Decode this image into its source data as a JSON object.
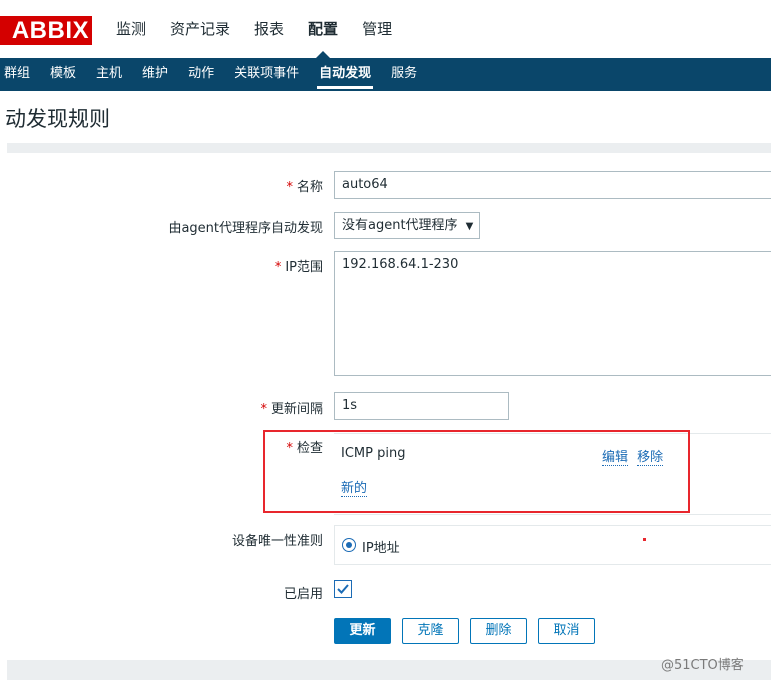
{
  "header": {
    "logo_text": "ABBIX",
    "main_menu": [
      "监测",
      "资产记录",
      "报表",
      "配置",
      "管理"
    ],
    "active_main": "配置"
  },
  "submenu": {
    "items": [
      "群组",
      "模板",
      "主机",
      "维护",
      "动作",
      "关联项事件",
      "自动发现",
      "服务"
    ],
    "active": "自动发现"
  },
  "page": {
    "title": "动发现规则"
  },
  "form": {
    "required_mark": "*",
    "name_label": "名称",
    "name_value": "auto64",
    "proxy_label": "由agent代理程序自动发现",
    "proxy_value": "没有agent代理程序",
    "ip_label": "IP范围",
    "ip_value": "192.168.64.1-230",
    "interval_label": "更新间隔",
    "interval_value": "1s",
    "checks_label": "检查",
    "check_item": "ICMP ping",
    "edit_link": "编辑",
    "remove_link": "移除",
    "new_link": "新的",
    "uniqueness_label": "设备唯一性准则",
    "uniqueness_value": "IP地址",
    "enabled_label": "已启用",
    "enabled_checked": true
  },
  "buttons": {
    "update": "更新",
    "clone": "克隆",
    "delete": "删除",
    "cancel": "取消"
  },
  "watermark": "@51CTO博客",
  "colors": {
    "brand_red": "#d40000",
    "nav_dark": "#0a466a",
    "accent_blue": "#0275b8",
    "highlight_red": "#e8262d"
  }
}
